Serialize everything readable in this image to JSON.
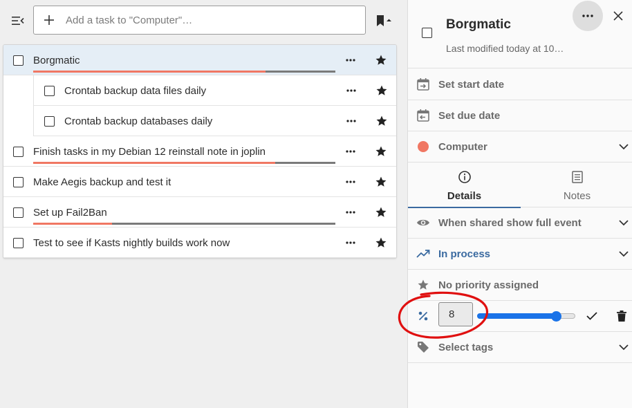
{
  "toolbar": {
    "menu_icon": "collapse-menu-icon",
    "add_placeholder": "Add a task to \"Computer\"…",
    "bookmark_icon": "bookmark-dropdown-icon"
  },
  "tasks": [
    {
      "title": "Borgmatic",
      "selected": true,
      "child": false,
      "progress": 0.77
    },
    {
      "title": "Crontab backup data files daily",
      "selected": false,
      "child": true
    },
    {
      "title": "Crontab backup databases daily",
      "selected": false,
      "child": true
    },
    {
      "title": "Finish tasks in my Debian 12 reinstall note in joplin",
      "selected": false,
      "child": false,
      "progress": 0.8
    },
    {
      "title": "Make Aegis backup and test it",
      "selected": false,
      "child": false
    },
    {
      "title": "Set up Fail2Ban",
      "selected": false,
      "child": false,
      "progress": 0.26
    },
    {
      "title": "Test to see if Kasts nightly builds work now",
      "selected": false,
      "child": false
    }
  ],
  "detail": {
    "title": "Borgmatic",
    "modified": "Last modified today at 10…",
    "start_date": "Set start date",
    "due_date": "Set due date",
    "collection": "Computer",
    "collection_color": "#f07763",
    "tabs": [
      {
        "label": "Details",
        "icon": "info-icon",
        "active": true
      },
      {
        "label": "Notes",
        "icon": "notes-icon",
        "active": false
      }
    ],
    "visibility": "When shared show full event",
    "status": "In process",
    "priority": "No priority assigned",
    "percent_value": "8",
    "slider_value": 0.8,
    "tags": "Select tags"
  },
  "colors": {
    "accent": "#1a73e8",
    "status_blue": "#3a6aa0",
    "progress_fill": "#f07763",
    "annotation": "#e01010"
  }
}
